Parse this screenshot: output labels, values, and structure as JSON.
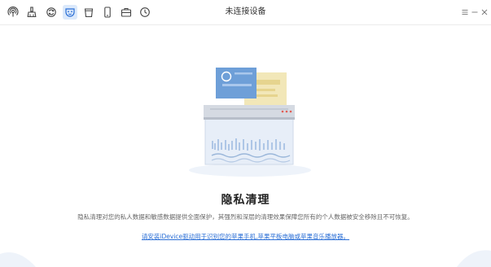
{
  "window": {
    "title": "未连接设备"
  },
  "toolbar": {
    "tools": [
      {
        "icon": "podcast-icon"
      },
      {
        "icon": "broom-icon"
      },
      {
        "icon": "sync-icon"
      },
      {
        "icon": "privacy-mask-icon",
        "active": true
      },
      {
        "icon": "trash-icon"
      },
      {
        "icon": "phone-icon"
      },
      {
        "icon": "toolbox-icon"
      },
      {
        "icon": "history-icon"
      }
    ],
    "controls": [
      "menu-icon",
      "minimize-icon",
      "close-icon"
    ]
  },
  "main": {
    "heading": "隐私清理",
    "description": "隐私清理对您的私人数据和敏感数据提供全面保护，其强烈和深层的清理效果保障您所有的个人数据被安全移除且不可恢复。",
    "link": "请安装iDevice驱动用于识别您的苹果手机,苹果平板电脑或苹果音乐播放器。"
  },
  "colors": {
    "accent": "#2b6fd6",
    "active_tab_bg": "#dbe9fb",
    "shredder": "#d5dae2",
    "paper_blue": "#6e9fd8",
    "paper_yellow": "#f2e7b8"
  }
}
